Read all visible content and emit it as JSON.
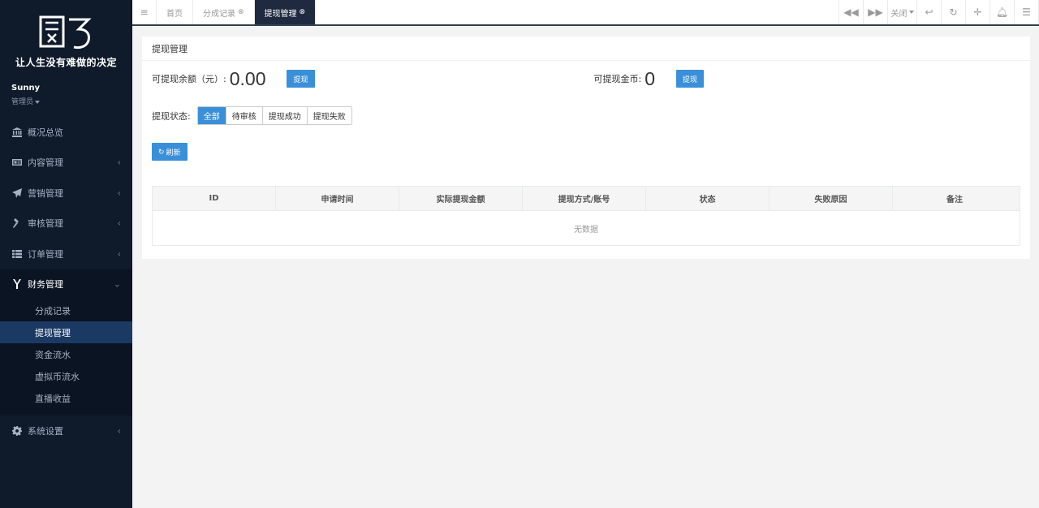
{
  "sidebar": {
    "slogan": "让人生没有难做的决定",
    "user_name": "Sunny",
    "user_role": "管理员",
    "items": [
      {
        "label": "概况总览",
        "icon": "bank-icon"
      },
      {
        "label": "内容管理",
        "icon": "newspaper-icon"
      },
      {
        "label": "营销管理",
        "icon": "paper-plane-icon"
      },
      {
        "label": "审核管理",
        "icon": "gavel-icon"
      },
      {
        "label": "订单管理",
        "icon": "list-icon"
      },
      {
        "label": "财务管理",
        "icon": "yen-icon"
      },
      {
        "label": "系统设置",
        "icon": "gear-icon"
      }
    ],
    "finance_sub": [
      "分成记录",
      "提现管理",
      "资金流水",
      "虚拟币流水",
      "直播收益"
    ]
  },
  "topbar": {
    "tabs": [
      "首页",
      "分成记录",
      "提现管理"
    ],
    "close_label": "关闭"
  },
  "content": {
    "title": "提现管理",
    "balance_label": "可提现余额（元）:",
    "balance_value": "0.00",
    "coin_label": "可提现金币:",
    "coin_value": "0",
    "withdraw_btn": "提现",
    "status_label": "提现状态:",
    "status_options": [
      "全部",
      "待审核",
      "提现成功",
      "提现失败"
    ],
    "refresh_label": "刷新",
    "table": {
      "columns": [
        "ID",
        "申请时间",
        "实际提现金额",
        "提现方式/账号",
        "状态",
        "失败原因",
        "备注"
      ],
      "empty_text": "无数据"
    }
  }
}
